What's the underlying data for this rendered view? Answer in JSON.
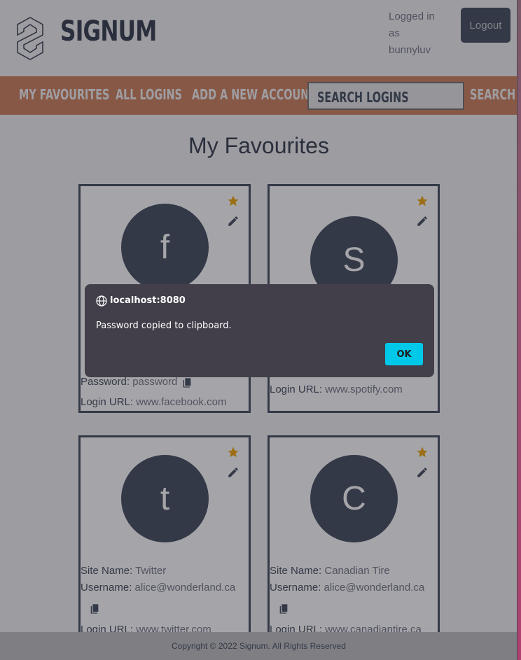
{
  "header": {
    "brand": "SIGNUM",
    "logged_in_prefix": "Logged in as",
    "username": "bunnyluv",
    "logout_label": "Logout"
  },
  "nav": {
    "items": [
      {
        "label": "My Favourites"
      },
      {
        "label": "All Logins"
      },
      {
        "label": "Add a new account"
      }
    ],
    "search_placeholder": "Search Logins",
    "search_label": "Search"
  },
  "page_title": "My Favourites",
  "labels": {
    "site_name": "Site Name:",
    "username": "Username:",
    "password": "Password:",
    "login_url": "Login URL:"
  },
  "cards": [
    {
      "initial": "f",
      "password": "password",
      "login_url": "www.facebook.com"
    },
    {
      "initial": "S",
      "login_url": "www.spotify.com"
    },
    {
      "initial": "t",
      "site_name": "Twitter",
      "username": "alice@wonderland.ca",
      "login_url": "www.twitter.com"
    },
    {
      "initial": "C",
      "site_name": "Canadian Tire",
      "username": "alice@wonderland.ca",
      "login_url": "www.canadiantire.ca"
    }
  ],
  "footer": "Copyright © 2022 Signum. All Rights Reserved",
  "dialog": {
    "origin": "localhost:8080",
    "message": "Password copied to clipboard.",
    "ok_label": "OK"
  },
  "colors": {
    "accent_nav": "#cd7a55",
    "primary": "#3b4556",
    "favourite_star": "#f0a000",
    "dialog_button": "#00c8e8"
  }
}
